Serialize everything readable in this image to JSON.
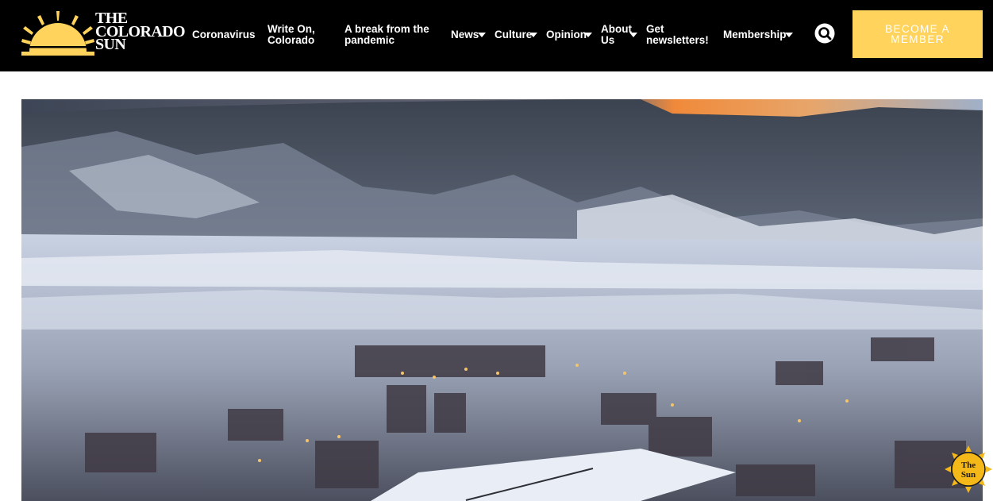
{
  "site": {
    "logo_line1": "THE",
    "logo_line2": "COLORADO",
    "logo_line3": "SUN",
    "logo_icon": "sun-logo-icon"
  },
  "nav": {
    "coronavirus": "Coronavirus",
    "write_on_1": "Write On,",
    "write_on_2": "Colorado",
    "break_1": "A break from the",
    "break_2": "pandemic",
    "news": "News",
    "culture": "Culture",
    "opinion": "Opinion",
    "about_1": "About",
    "about_2": "Us",
    "newsletters_1": "Get",
    "newsletters_2": "newsletters!",
    "membership": "Membership"
  },
  "actions": {
    "search_icon": "search-icon",
    "become_member": "BECOME A MEMBER"
  },
  "hero": {
    "alt": "Snowy mountain town at dusk"
  },
  "badge": {
    "line1": "The",
    "line2": "Sun"
  },
  "colors": {
    "header_bg": "#000000",
    "accent_yellow": "#ffd35c",
    "text_white": "#ffffff"
  }
}
